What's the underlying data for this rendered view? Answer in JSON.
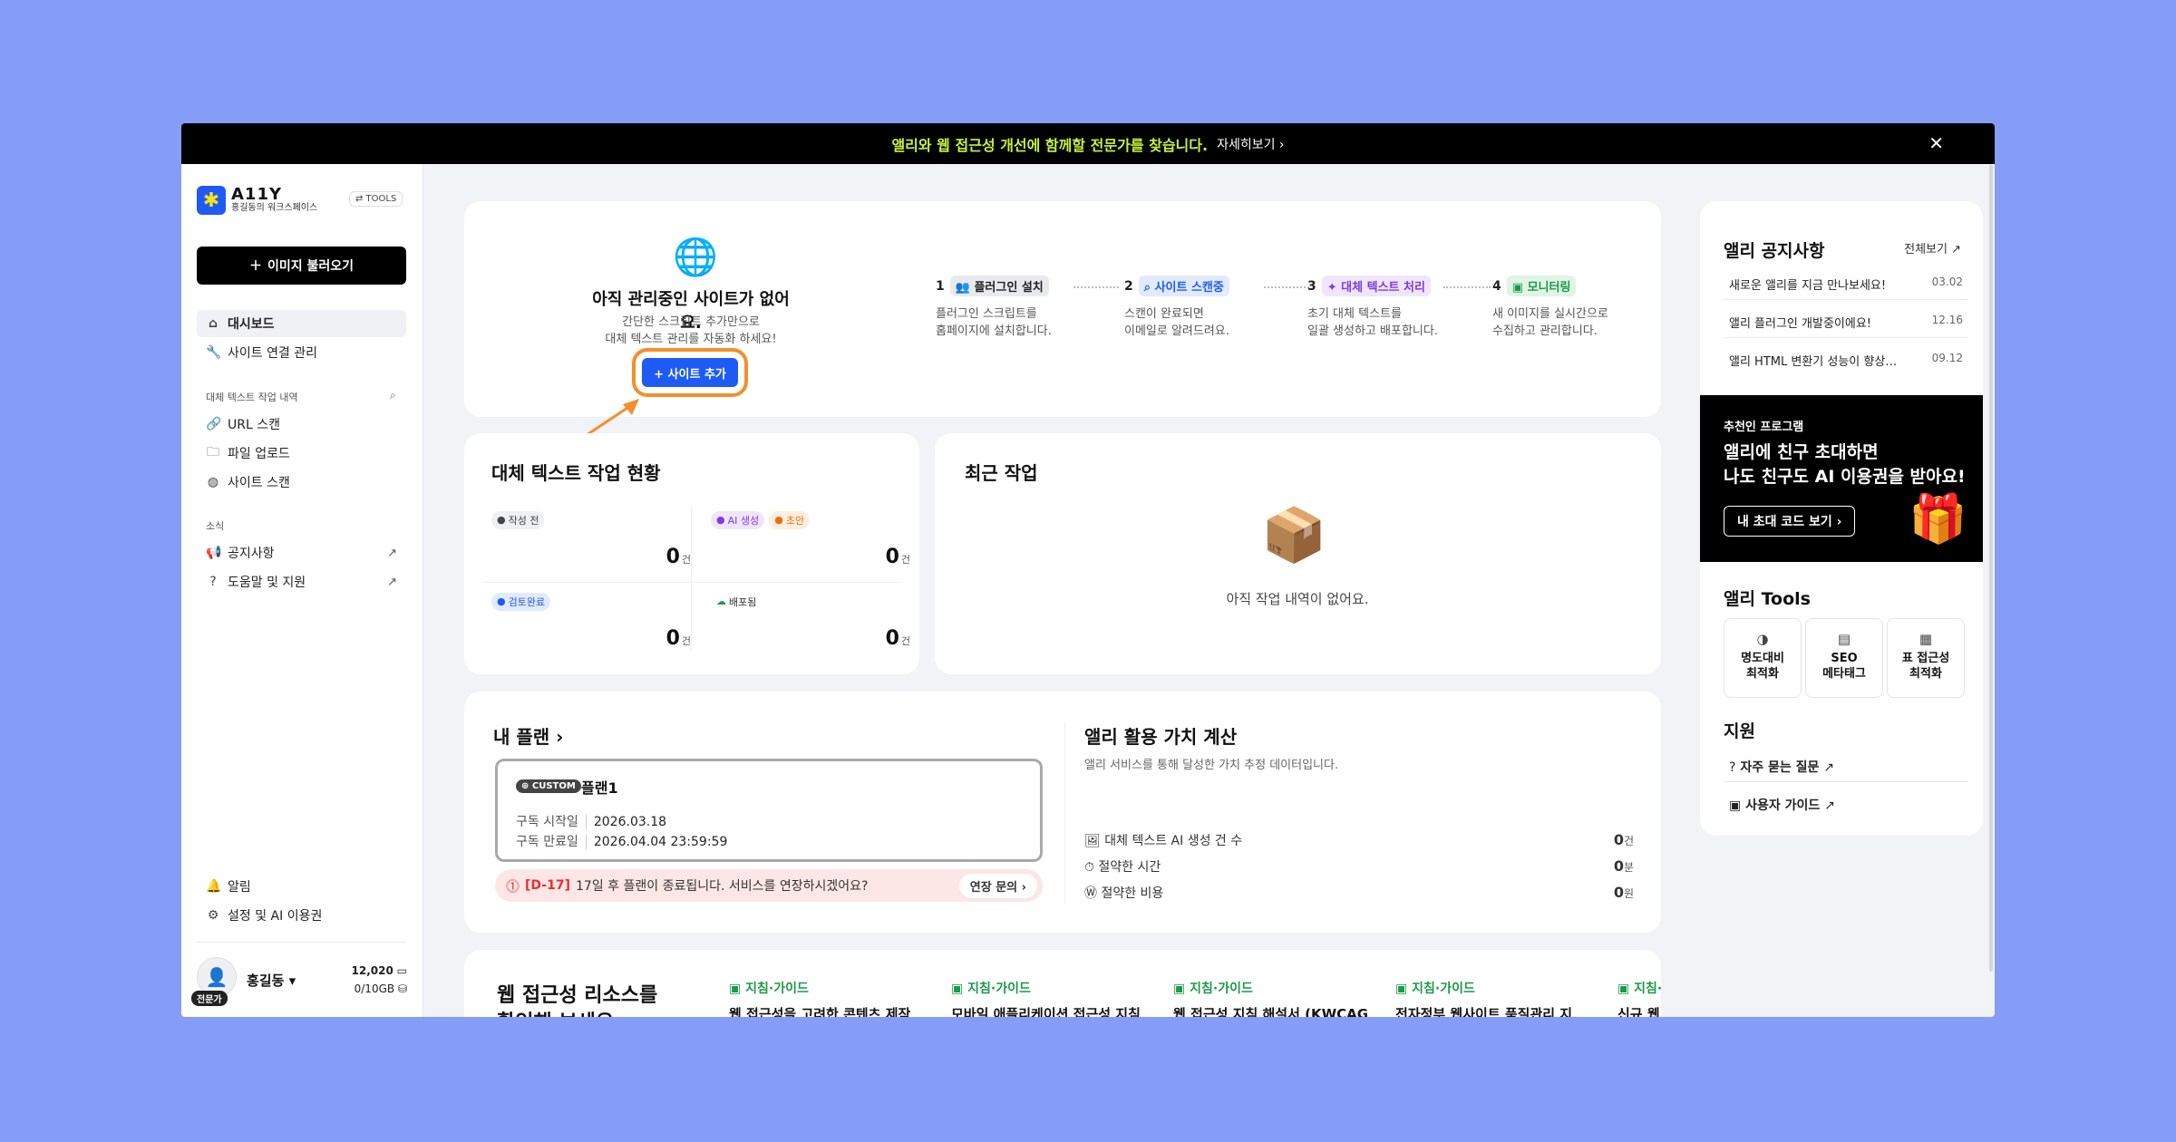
{
  "banner": {
    "message": "앨리와 웹 접근성 개선에 함께할 전문가를 찾습니다.",
    "link": "자세히보기 ›",
    "close": "✕"
  },
  "sidebar": {
    "logo": {
      "name": "A11Y",
      "sub": "홍길동의 워크스페이스",
      "tools": "⇄ TOOLS"
    },
    "import_button": "이미지 불러오기",
    "nav": [
      {
        "label": "대시보드",
        "icon": "home-icon"
      },
      {
        "label": "사이트 연결 관리",
        "icon": "wrench-icon"
      }
    ],
    "section_work": "대체 텍스트 작업 내역",
    "work_items": [
      {
        "label": "URL 스캔",
        "icon": "link-icon"
      },
      {
        "label": "파일 업로드",
        "icon": "folder-icon"
      },
      {
        "label": "사이트 스캔",
        "icon": "globe-icon"
      }
    ],
    "section_news": "소식",
    "news_items": [
      {
        "label": "공지사항",
        "icon": "megaphone-icon"
      },
      {
        "label": "도움말 및 지원",
        "icon": "help-icon"
      }
    ],
    "bottom_items": [
      {
        "label": "알림",
        "icon": "bell-icon"
      },
      {
        "label": "설정 및 AI 이용권",
        "icon": "gear-icon"
      }
    ],
    "user": {
      "name": "홍길동 ▾",
      "badge": "전문가",
      "credits": "12,020",
      "storage": "0/10GB"
    }
  },
  "empty_sites": {
    "title": "아직 관리중인 사이트가 없어요.",
    "sub1": "간단한 스크립트 추가만으로",
    "sub2": "대체 텍스트 관리를 자동화 하세요!",
    "add_button": "+ 사이트 추가"
  },
  "steps": [
    {
      "num": "1",
      "label": "플러그인 설치",
      "desc1": "플러그인 스크립트를",
      "desc2": "홈페이지에 설치합니다."
    },
    {
      "num": "2",
      "label": "사이트 스캔중",
      "desc1": "스캔이 완료되면",
      "desc2": "이메일로 알려드려요."
    },
    {
      "num": "3",
      "label": "대체 텍스트 처리",
      "desc1": "초기 대체 텍스트를",
      "desc2": "일괄 생성하고 배포합니다."
    },
    {
      "num": "4",
      "label": "모니터링",
      "desc1": "새 이미지를 실시간으로",
      "desc2": "수집하고 관리합니다."
    }
  ],
  "status": {
    "title": "대체 텍스트 작업 현황",
    "cells": [
      {
        "badges": [
          "작성 전"
        ],
        "value": "0",
        "unit": "건"
      },
      {
        "badges": [
          "AI 생성",
          "초안"
        ],
        "value": "0",
        "unit": "건"
      },
      {
        "badges": [
          "검토완료"
        ],
        "value": "0",
        "unit": "건"
      },
      {
        "badges": [
          "배포됨"
        ],
        "value": "0",
        "unit": "건"
      }
    ]
  },
  "recent": {
    "title": "최근 작업",
    "empty": "아직 작업 내역이 없어요."
  },
  "plan": {
    "title": "내 플랜 ›",
    "badge": "CUSTOM",
    "name": "플랜1",
    "start_label": "구독 시작일",
    "start": "2026.03.18",
    "end_label": "구독 만료일",
    "end": "2026.04.04 23:59:59",
    "warn_d": "[D-17]",
    "warn_text": "17일 후 플랜이 종료됩니다. 서비스를 연장하시겠어요?",
    "extend": "연장 문의 ›"
  },
  "value": {
    "title": "앨리 활용 가치 계산",
    "sub": "앨리 서비스를 통해 달성한 가치 추정 데이터입니다.",
    "rows": [
      {
        "label": "대체 텍스트 AI 생성 건 수",
        "value": "0",
        "unit": "건"
      },
      {
        "label": "절약한 시간",
        "value": "0",
        "unit": "분"
      },
      {
        "label": "절약한 비용",
        "value": "0",
        "unit": "원"
      }
    ]
  },
  "resources": {
    "title1": "웹 접근성 리소스를",
    "title2": "확인해 보세요",
    "items": [
      {
        "tag": "지침·가이드",
        "name": "웹 접근성을 고려한 콘텐츠 제작"
      },
      {
        "tag": "지침·가이드",
        "name": "모바일 애플리케이션 접근성 지침"
      },
      {
        "tag": "지침·가이드",
        "name": "웹 접근성 지침 해설서 (KWCAG"
      },
      {
        "tag": "지침·가이드",
        "name": "전자정부 웹사이트 품질관리 지"
      },
      {
        "tag": "지침·",
        "name": "신규 웹"
      }
    ]
  },
  "notices": {
    "title": "앨리 공지사항",
    "all": "전체보기",
    "items": [
      {
        "title": "새로운 앨리를 지금 만나보세요!",
        "date": "03.02"
      },
      {
        "title": "앨리 플러그인 개발중이에요!",
        "date": "12.16"
      },
      {
        "title": "앨리 HTML 변환기 성능이 향상…",
        "date": "09.12"
      }
    ]
  },
  "promo": {
    "eyebrow": "추천인 프로그램",
    "line1": "앨리에 친구 초대하면",
    "line2": "나도 친구도 AI 이용권을 받아요!",
    "button": "내 초대 코드 보기 ›"
  },
  "tools": {
    "title": "앨리 Tools",
    "items": [
      {
        "l1": "명도대비",
        "l2": "최적화",
        "icon": "contrast-icon"
      },
      {
        "l1": "SEO",
        "l2": "메타태그",
        "icon": "seo-icon"
      },
      {
        "l1": "표 접근성",
        "l2": "최적화",
        "icon": "table-icon"
      }
    ]
  },
  "support": {
    "title": "지원",
    "faq": "자주 묻는 질문",
    "guide": "사용자 가이드"
  },
  "colors": {
    "accent": "#1e5bf5",
    "highlight": "#f58e2e",
    "banner_text": "#c7f23a",
    "background": "#859df7"
  }
}
